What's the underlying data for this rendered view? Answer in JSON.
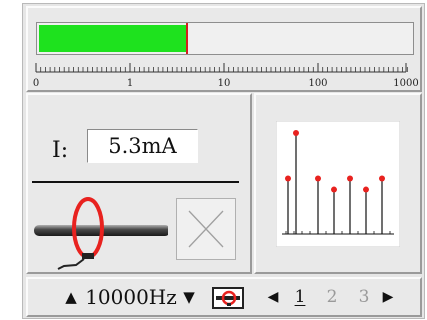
{
  "meter": {
    "fill_fraction": 0.397,
    "peak_fraction": 0.397,
    "colors": {
      "fill": "#1ee21e",
      "peak": "#d21f1f",
      "track": "#f0f0f0"
    },
    "scale_labels": [
      "0",
      "1",
      "10",
      "100",
      "1000"
    ]
  },
  "reading": {
    "label": "I:",
    "value": "5.3mA"
  },
  "clamp_icon": {
    "icon": "current-clamp-icon",
    "color": "#e8221f"
  },
  "status_box": {
    "icon": "x-mark-icon"
  },
  "spectrum": {
    "icon": "harmonic-spectrum-icon",
    "marker_color": "#e8221f",
    "bars": [
      0.55,
      1.0,
      0.55,
      0.44,
      0.55,
      0.44,
      0.55
    ]
  },
  "toolbar": {
    "freq_up_icon": "triangle-up-icon",
    "freq_up_glyph": "▲",
    "frequency": "10000Hz",
    "freq_down_icon": "triangle-down-icon",
    "freq_down_glyph": "▼",
    "clamp_mode_icon": "clamp-mode-icon",
    "prev_glyph": "◀",
    "next_glyph": "▶",
    "pages": [
      "1",
      "2",
      "3"
    ],
    "active_page": "1"
  }
}
